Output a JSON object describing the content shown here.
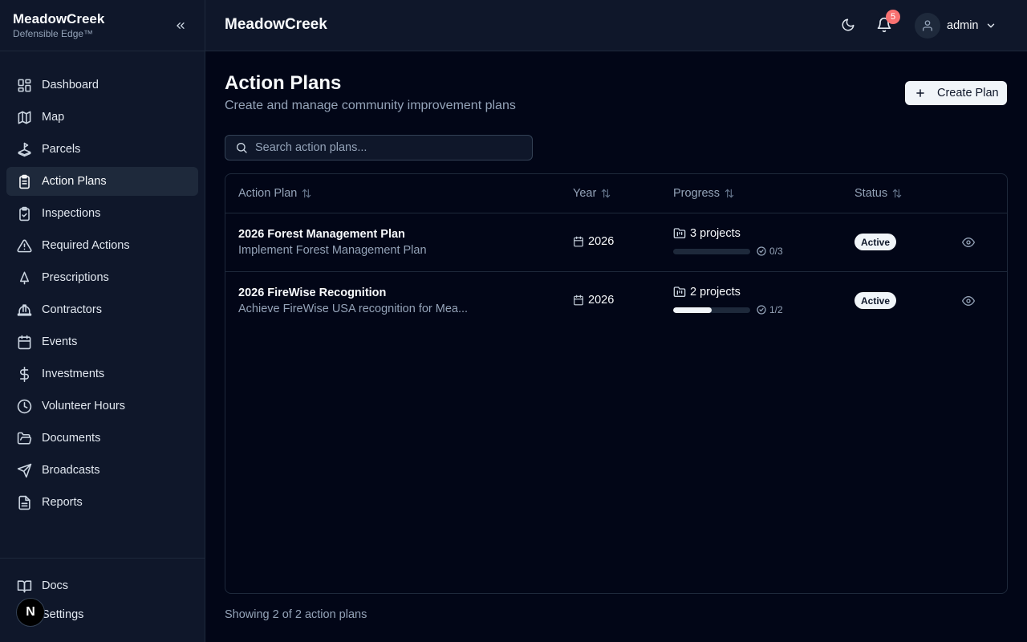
{
  "brand": {
    "name": "MeadowCreek",
    "tagline": "Defensible Edge™"
  },
  "sidebar": {
    "items": [
      {
        "label": "Dashboard",
        "icon": "dashboard-icon"
      },
      {
        "label": "Map",
        "icon": "map-icon"
      },
      {
        "label": "Parcels",
        "icon": "parcels-icon"
      },
      {
        "label": "Action Plans",
        "icon": "clipboard-icon",
        "active": true
      },
      {
        "label": "Inspections",
        "icon": "clipboard-check-icon"
      },
      {
        "label": "Required Actions",
        "icon": "warning-icon"
      },
      {
        "label": "Prescriptions",
        "icon": "tree-icon"
      },
      {
        "label": "Contractors",
        "icon": "hard-hat-icon"
      },
      {
        "label": "Events",
        "icon": "calendar-icon"
      },
      {
        "label": "Investments",
        "icon": "dollar-icon"
      },
      {
        "label": "Volunteer Hours",
        "icon": "clock-icon"
      },
      {
        "label": "Documents",
        "icon": "folder-open-icon"
      },
      {
        "label": "Broadcasts",
        "icon": "send-icon"
      },
      {
        "label": "Reports",
        "icon": "file-text-icon"
      }
    ],
    "bottom": [
      {
        "label": "Docs",
        "icon": "book-icon"
      },
      {
        "label": "Settings",
        "icon": "gear-icon"
      }
    ],
    "n_badge": "N"
  },
  "header": {
    "title": "MeadowCreek",
    "notification_count": "5",
    "user": "admin"
  },
  "page": {
    "title": "Action Plans",
    "subtitle": "Create and manage community improvement plans",
    "create_label": "Create Plan",
    "search_placeholder": "Search action plans...",
    "columns": {
      "plan": "Action Plan",
      "year": "Year",
      "progress": "Progress",
      "status": "Status"
    },
    "rows": [
      {
        "name": "2026 Forest Management Plan",
        "description": "Implement Forest Management Plan",
        "year": "2026",
        "projects": "3 projects",
        "completed": "0/3",
        "progress": 0,
        "status": "Active"
      },
      {
        "name": "2026 FireWise Recognition",
        "description": "Achieve FireWise USA recognition for Mea...",
        "year": "2026",
        "projects": "2 projects",
        "completed": "1/2",
        "progress": 0.5,
        "status": "Active"
      }
    ],
    "footer": "Showing 2 of 2 action plans"
  },
  "colors": {
    "background": "#020617",
    "panel": "#0f172a",
    "border": "#1e293b",
    "muted": "#94a3b8",
    "accent": "#f1f5f9",
    "badge": "#f87171"
  }
}
